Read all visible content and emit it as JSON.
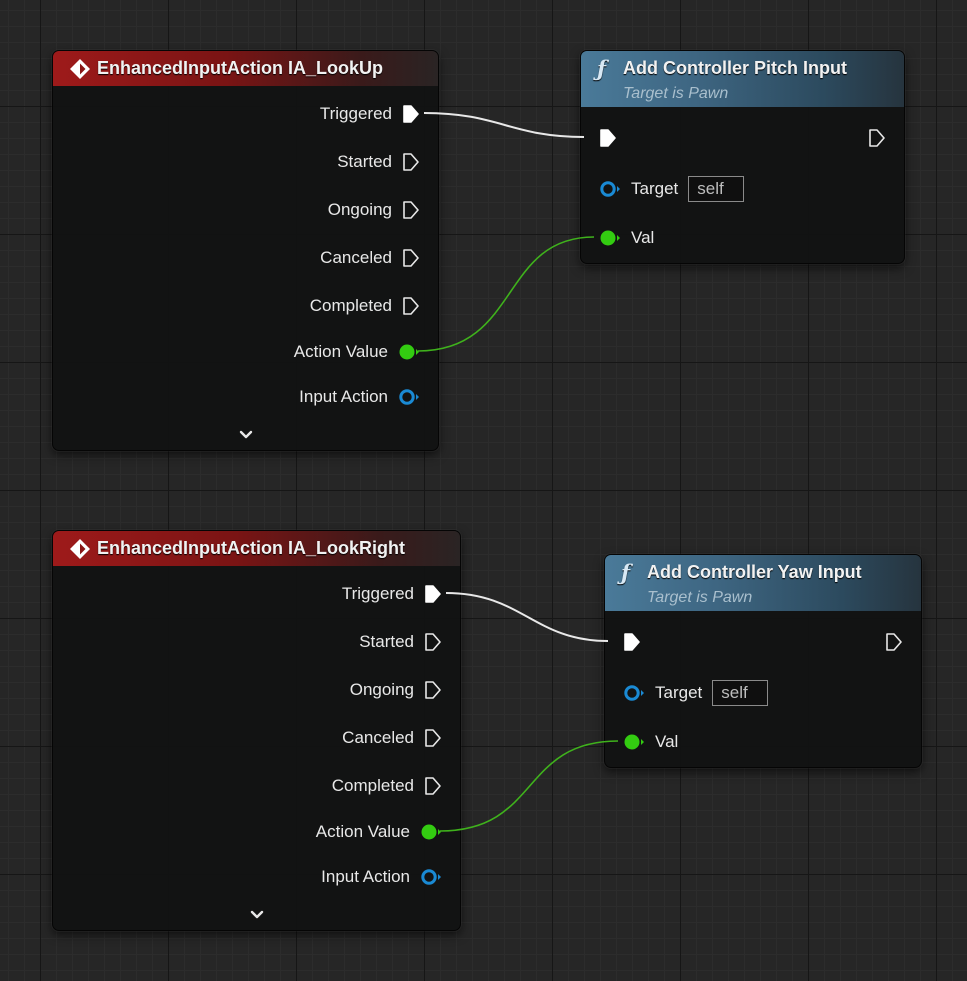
{
  "events": [
    {
      "title": "EnhancedInputAction IA_LookUp",
      "pins": {
        "triggered": "Triggered",
        "started": "Started",
        "ongoing": "Ongoing",
        "canceled": "Canceled",
        "completed": "Completed",
        "action_value": "Action Value",
        "input_action": "Input Action"
      },
      "icon": "event-diamond-icon",
      "expand_icon": "chevron-down-icon"
    },
    {
      "title": "EnhancedInputAction IA_LookRight",
      "pins": {
        "triggered": "Triggered",
        "started": "Started",
        "ongoing": "Ongoing",
        "canceled": "Canceled",
        "completed": "Completed",
        "action_value": "Action Value",
        "input_action": "Input Action"
      },
      "icon": "event-diamond-icon",
      "expand_icon": "chevron-down-icon"
    }
  ],
  "functions": [
    {
      "title": "Add Controller Pitch Input",
      "subtitle": "Target is Pawn",
      "target_label": "Target",
      "target_value": "self",
      "val_label": "Val",
      "icon": "function-f-icon"
    },
    {
      "title": "Add Controller Yaw Input",
      "subtitle": "Target is Pawn",
      "target_label": "Target",
      "target_value": "self",
      "val_label": "Val",
      "icon": "function-f-icon"
    }
  ],
  "colors": {
    "event_header": "#9e1a1a",
    "function_header": "#4a7a99",
    "float_pin": "#33cc11",
    "object_pin": "#1a8ad4",
    "exec_pin": "#ffffff",
    "exec_wire": "#e8e8e8",
    "float_wire": "#3fb21c"
  }
}
